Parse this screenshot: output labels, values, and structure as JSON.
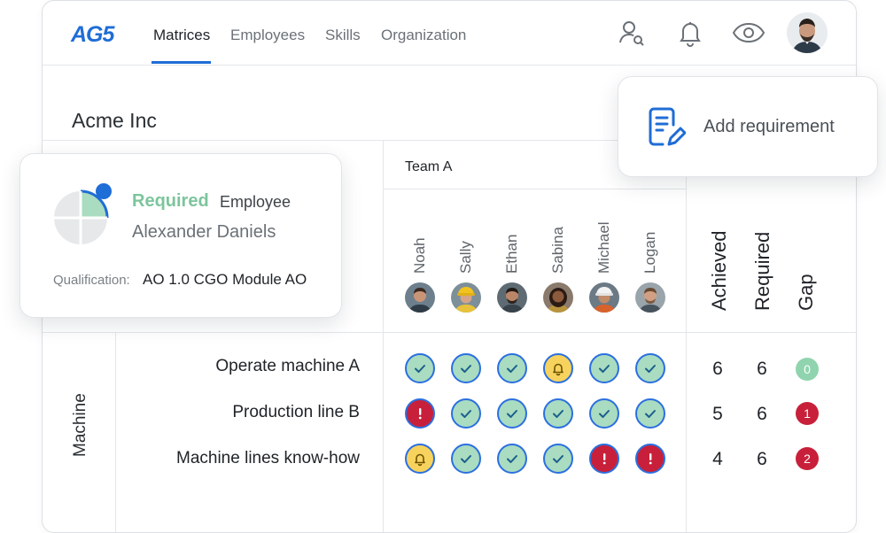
{
  "brand": {
    "logo_text": "AG5",
    "accent": "#1f6dd6"
  },
  "nav": {
    "tabs": [
      {
        "label": "Matrices",
        "active": true
      },
      {
        "label": "Employees",
        "active": false
      },
      {
        "label": "Skills",
        "active": false
      },
      {
        "label": "Organization",
        "active": false
      }
    ],
    "icons": [
      "user-search-icon",
      "bell-icon",
      "eye-icon",
      "profile-avatar"
    ]
  },
  "matrix": {
    "company": "Acme Inc",
    "team": "Team A",
    "employees": [
      "Noah",
      "Sally",
      "Ethan",
      "Sabina",
      "Michael",
      "Logan"
    ],
    "summary_headers": [
      "Achieved",
      "Required",
      "Gap"
    ],
    "group": "Machine",
    "rows": [
      {
        "skill": "Operate machine A",
        "cells": [
          "ok",
          "ok",
          "ok",
          "warn",
          "ok",
          "ok"
        ],
        "achieved": "6",
        "required": "6",
        "gap": "0",
        "gap_status": "ok"
      },
      {
        "skill": "Production line B",
        "cells": [
          "bad",
          "ok",
          "ok",
          "ok",
          "ok",
          "ok"
        ],
        "achieved": "5",
        "required": "6",
        "gap": "1",
        "gap_status": "bad"
      },
      {
        "skill": "Machine lines know-how",
        "cells": [
          "warn",
          "ok",
          "ok",
          "ok",
          "bad",
          "bad"
        ],
        "achieved": "4",
        "required": "6",
        "gap": "2",
        "gap_status": "bad"
      }
    ]
  },
  "requirement_card": {
    "status": "Required",
    "type": "Employee",
    "name": "Alexander Daniels",
    "qualification_label": "Qualification:",
    "qualification_value": "AO 1.0 CGO Module AO"
  },
  "add_requirement": {
    "label": "Add requirement"
  },
  "colors": {
    "ok": "#a9dcc0",
    "warn": "#f7d35e",
    "bad": "#c8203a",
    "gap_ok": "#8fd4ae",
    "gap_bad": "#c8203a",
    "required_text": "#7cc59c"
  }
}
